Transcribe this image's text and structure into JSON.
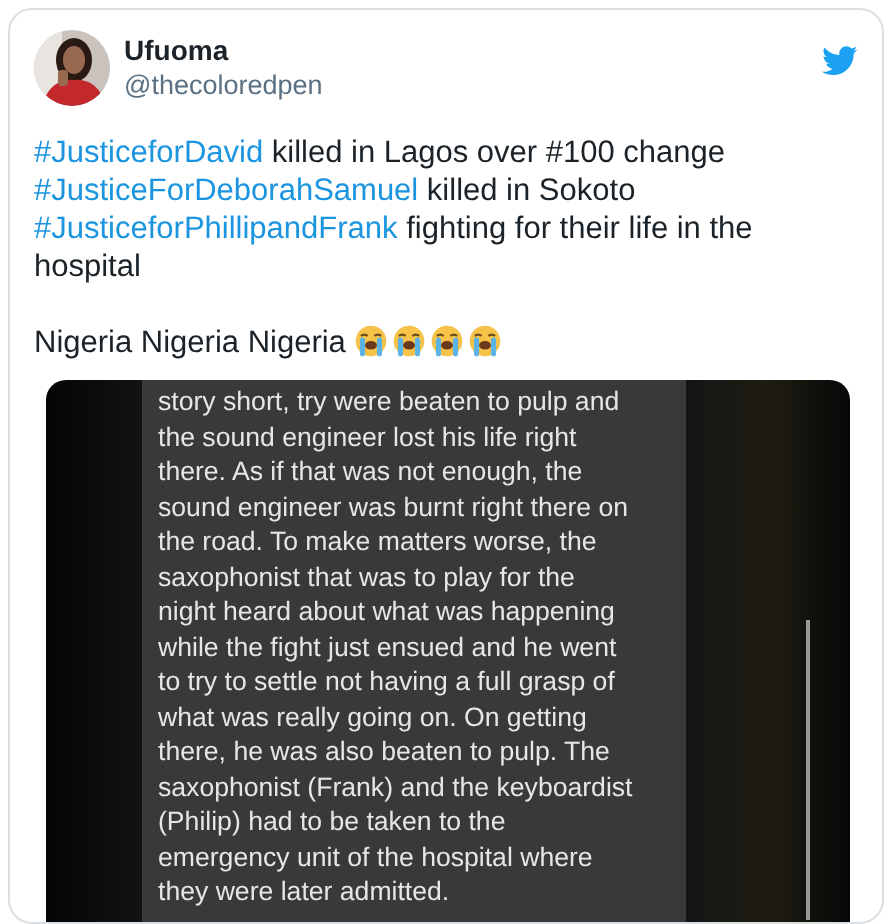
{
  "author": {
    "name": "Ufuoma",
    "handle": "@thecoloredpen"
  },
  "tweet": {
    "paragraphs": [
      [
        {
          "kind": "hashtag",
          "text": "#JusticeforDavid"
        },
        {
          "kind": "text",
          "text": " killed in Lagos over #100 change"
        },
        {
          "kind": "break"
        },
        {
          "kind": "hashtag",
          "text": "#JusticeForDeborahSamuel"
        },
        {
          "kind": "text",
          "text": " killed in Sokoto"
        },
        {
          "kind": "break"
        },
        {
          "kind": "hashtag",
          "text": "#JusticeforPhillipandFrank"
        },
        {
          "kind": "text",
          "text": " fighting for their life in the hospital"
        }
      ],
      [
        {
          "kind": "text",
          "text": "Nigeria Nigeria Nigeria "
        }
      ]
    ],
    "emojis": [
      {
        "kind": "loudly-crying"
      },
      {
        "kind": "loudly-crying"
      },
      {
        "kind": "loudly-crying"
      },
      {
        "kind": "loudly-crying"
      }
    ]
  },
  "media": {
    "text": "story short, try were beaten to pulp and\nthe sound engineer lost his life right\nthere. As if that was not enough, the\nsound engineer was burnt right there on\nthe road. To make matters worse, the\nsaxophonist that was to play for the\nnight heard about what was happening\nwhile the fight just ensued and he went\nto try to settle not having a full grasp of\nwhat was really going on. On getting\nthere, he was also beaten to pulp. The\nsaxophonist (Frank) and the keyboardist\n(Philip) had to be taken to the\nemergency unit of the hospital where\nthey were later admitted."
  }
}
